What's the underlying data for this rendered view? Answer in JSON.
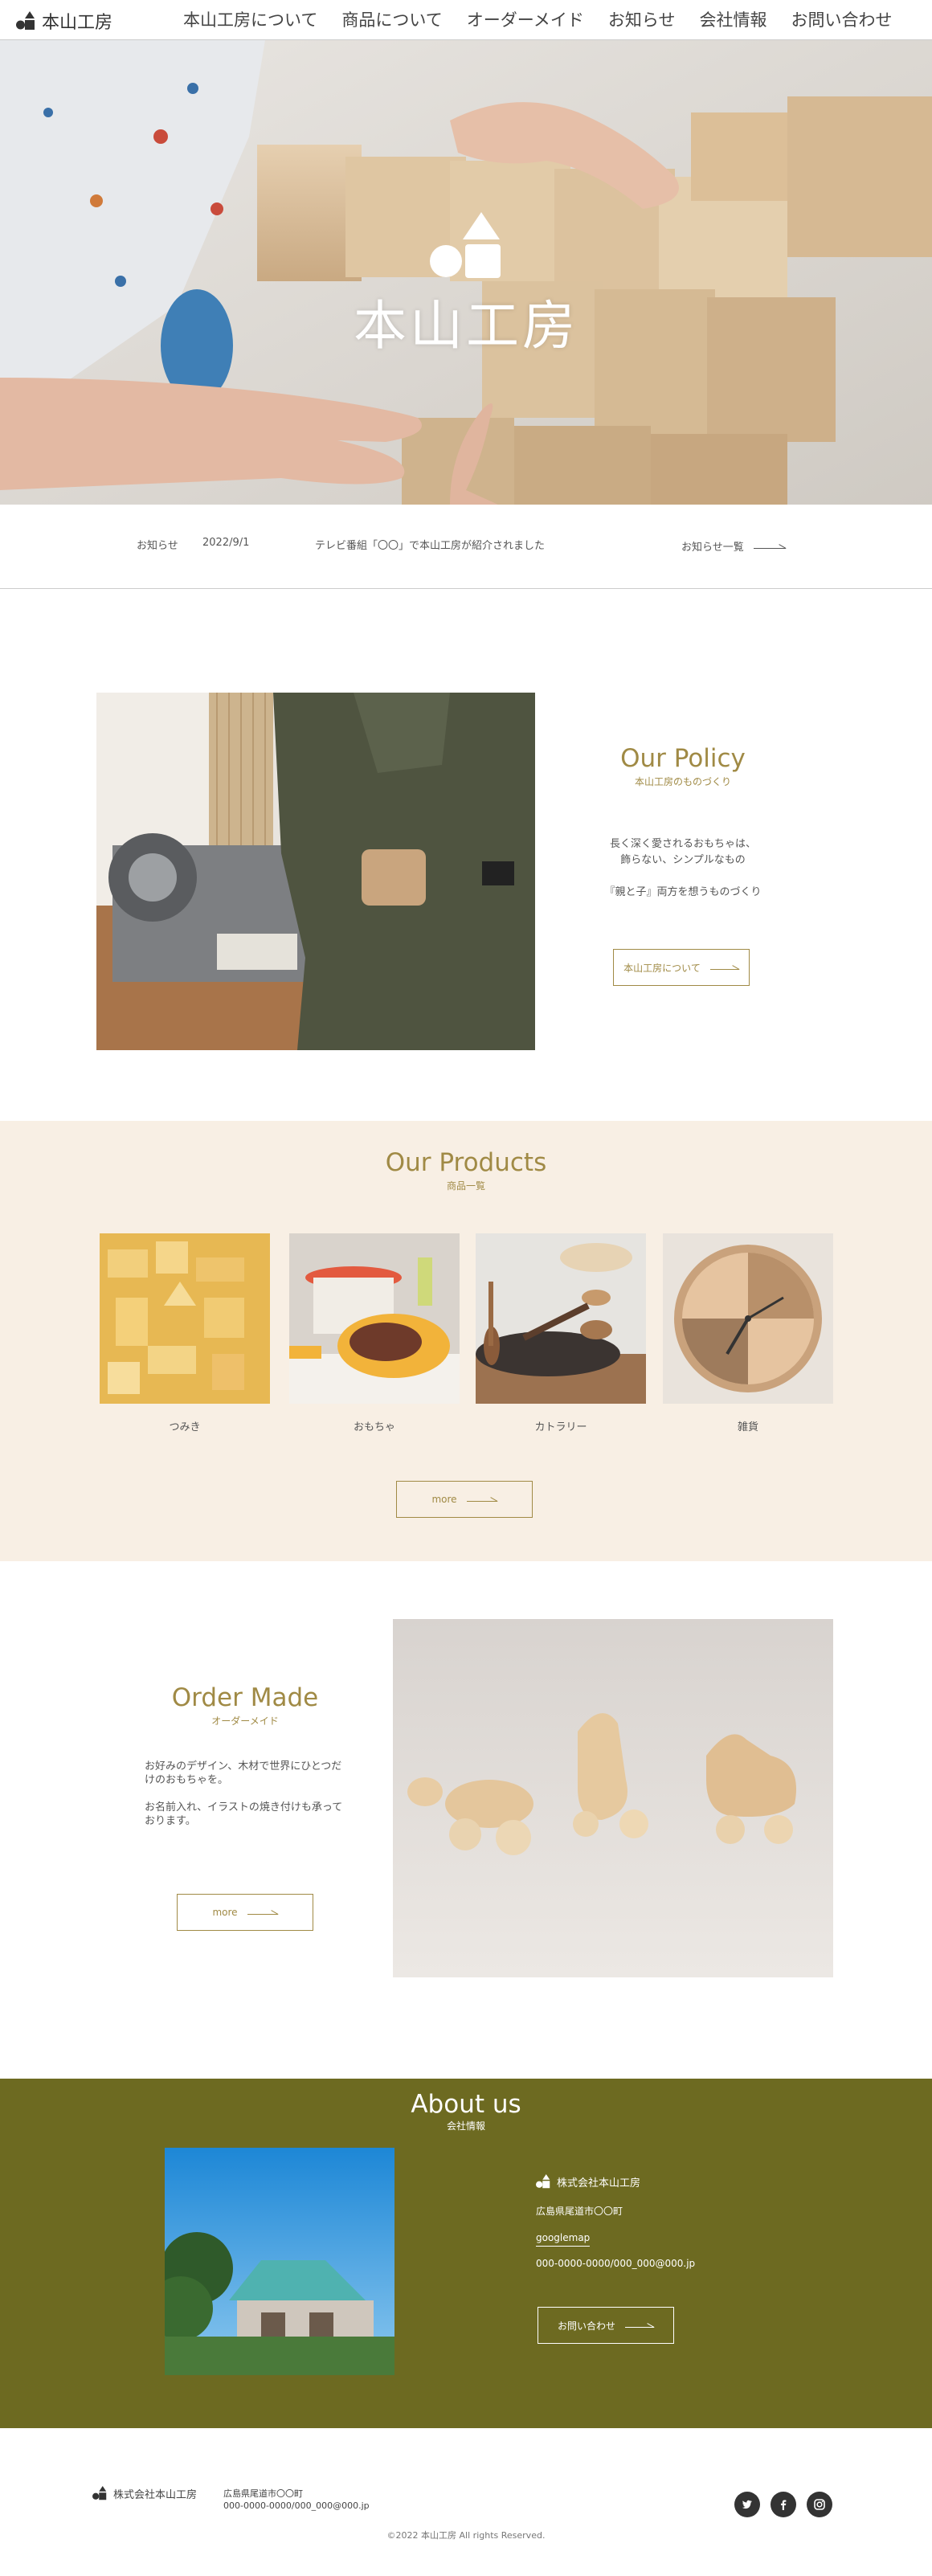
{
  "header": {
    "logo_text": "本山工房",
    "nav": [
      {
        "label": "本山工房について"
      },
      {
        "label": "商品について"
      },
      {
        "label": "オーダーメイド"
      },
      {
        "label": "お知らせ"
      },
      {
        "label": "会社情報"
      },
      {
        "label": "お問い合わせ"
      }
    ]
  },
  "hero": {
    "title": "本山工房"
  },
  "news": {
    "label": "お知らせ",
    "date": "2022/9/1",
    "text": "テレビ番組「〇〇」で本山工房が紹介されました",
    "more_label": "お知らせ一覧"
  },
  "policy": {
    "title": "Our Policy",
    "subtitle": "本山工房のものづくり",
    "line1": "長く深く愛されるおもちゃは、",
    "line2": "飾らない、シンプルなもの",
    "line3": "『親と子』両方を想うものづくり",
    "button_label": "本山工房について"
  },
  "products": {
    "title": "Our Products",
    "subtitle": "商品一覧",
    "items": [
      {
        "name": "つみき"
      },
      {
        "name": "おもちゃ"
      },
      {
        "name": "カトラリー"
      },
      {
        "name": "雑貨"
      }
    ],
    "button_label": "more"
  },
  "order": {
    "title": "Order Made",
    "subtitle": "オーダーメイド",
    "para1": "お好みのデザイン、木材で世界にひとつだけのおもちゃを。",
    "para2": "お名前入れ、イラストの焼き付けも承っております。",
    "button_label": "more"
  },
  "about": {
    "title": "About us",
    "subtitle": "会社情報",
    "company": "株式会社本山工房",
    "address": "広島県尾道市〇〇町",
    "map_link": "googlemap",
    "contact": "000-0000-0000/000_000@000.jp",
    "button_label": "お問い合わせ"
  },
  "footer": {
    "company": "株式会社本山工房",
    "address": "広島県尾道市〇〇町",
    "contact": "000-0000-0000/000_000@000.jp",
    "social": [
      {
        "icon": "twitter-icon"
      },
      {
        "icon": "facebook-icon"
      },
      {
        "icon": "instagram-icon"
      }
    ],
    "copyright": "©2022 本山工房 All rights Reserved."
  },
  "colors": {
    "accent": "#a08a45",
    "about_bg": "#6d6a21",
    "products_bg": "#f8efe4"
  }
}
